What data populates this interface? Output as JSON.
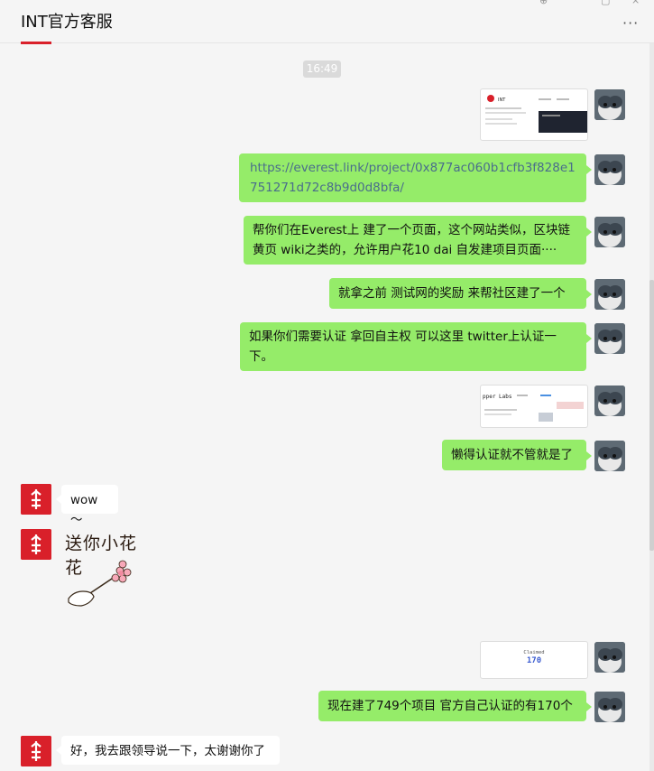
{
  "header": {
    "title": "INT官方客服",
    "more_icon": "more-icon",
    "win_pin": "⊕",
    "win_max": "▢",
    "win_close": "×"
  },
  "timestamp": "16:49",
  "messages": [
    {
      "side": "me",
      "type": "image",
      "desc": "everest project page screenshot"
    },
    {
      "side": "me",
      "type": "text",
      "text": "https://everest.link/project/0x877ac060b1cfb3f828e1751271d72c8b9d0d8bfa/"
    },
    {
      "side": "me",
      "type": "text",
      "text": "帮你们在Everest上 建了一个页面，这个网站类似，区块链黄页 wiki之类的，允许用户花10 dai 自发建项目页面····"
    },
    {
      "side": "me",
      "type": "text",
      "text": "就拿之前 测试网的奖励 来帮社区建了一个"
    },
    {
      "side": "me",
      "type": "text",
      "text": "如果你们需要认证 拿回自主权 可以这里 twitter上认证一下。"
    },
    {
      "side": "me",
      "type": "image",
      "desc": "twitter verification screenshot"
    },
    {
      "side": "me",
      "type": "text",
      "text": "懒得认证就不管就是了"
    },
    {
      "side": "them",
      "type": "text",
      "text": "wow～"
    },
    {
      "side": "them",
      "type": "sticker",
      "text": "送你小花花"
    },
    {
      "side": "me",
      "type": "image",
      "caption": "Claimed",
      "value": "170"
    },
    {
      "side": "me",
      "type": "text",
      "text": "现在建了749个项目 官方自己认证的有170个"
    },
    {
      "side": "them",
      "type": "text",
      "text": "好，我去跟领导说一下，太谢谢你了"
    }
  ],
  "thumbs": {
    "everest_logo": "INT",
    "twitter_title": "pper Labs"
  },
  "colors": {
    "bubble_me": "#95ec69",
    "bubble_them": "#ffffff",
    "brand_red": "#d9202a",
    "bg": "#f5f5f5"
  }
}
